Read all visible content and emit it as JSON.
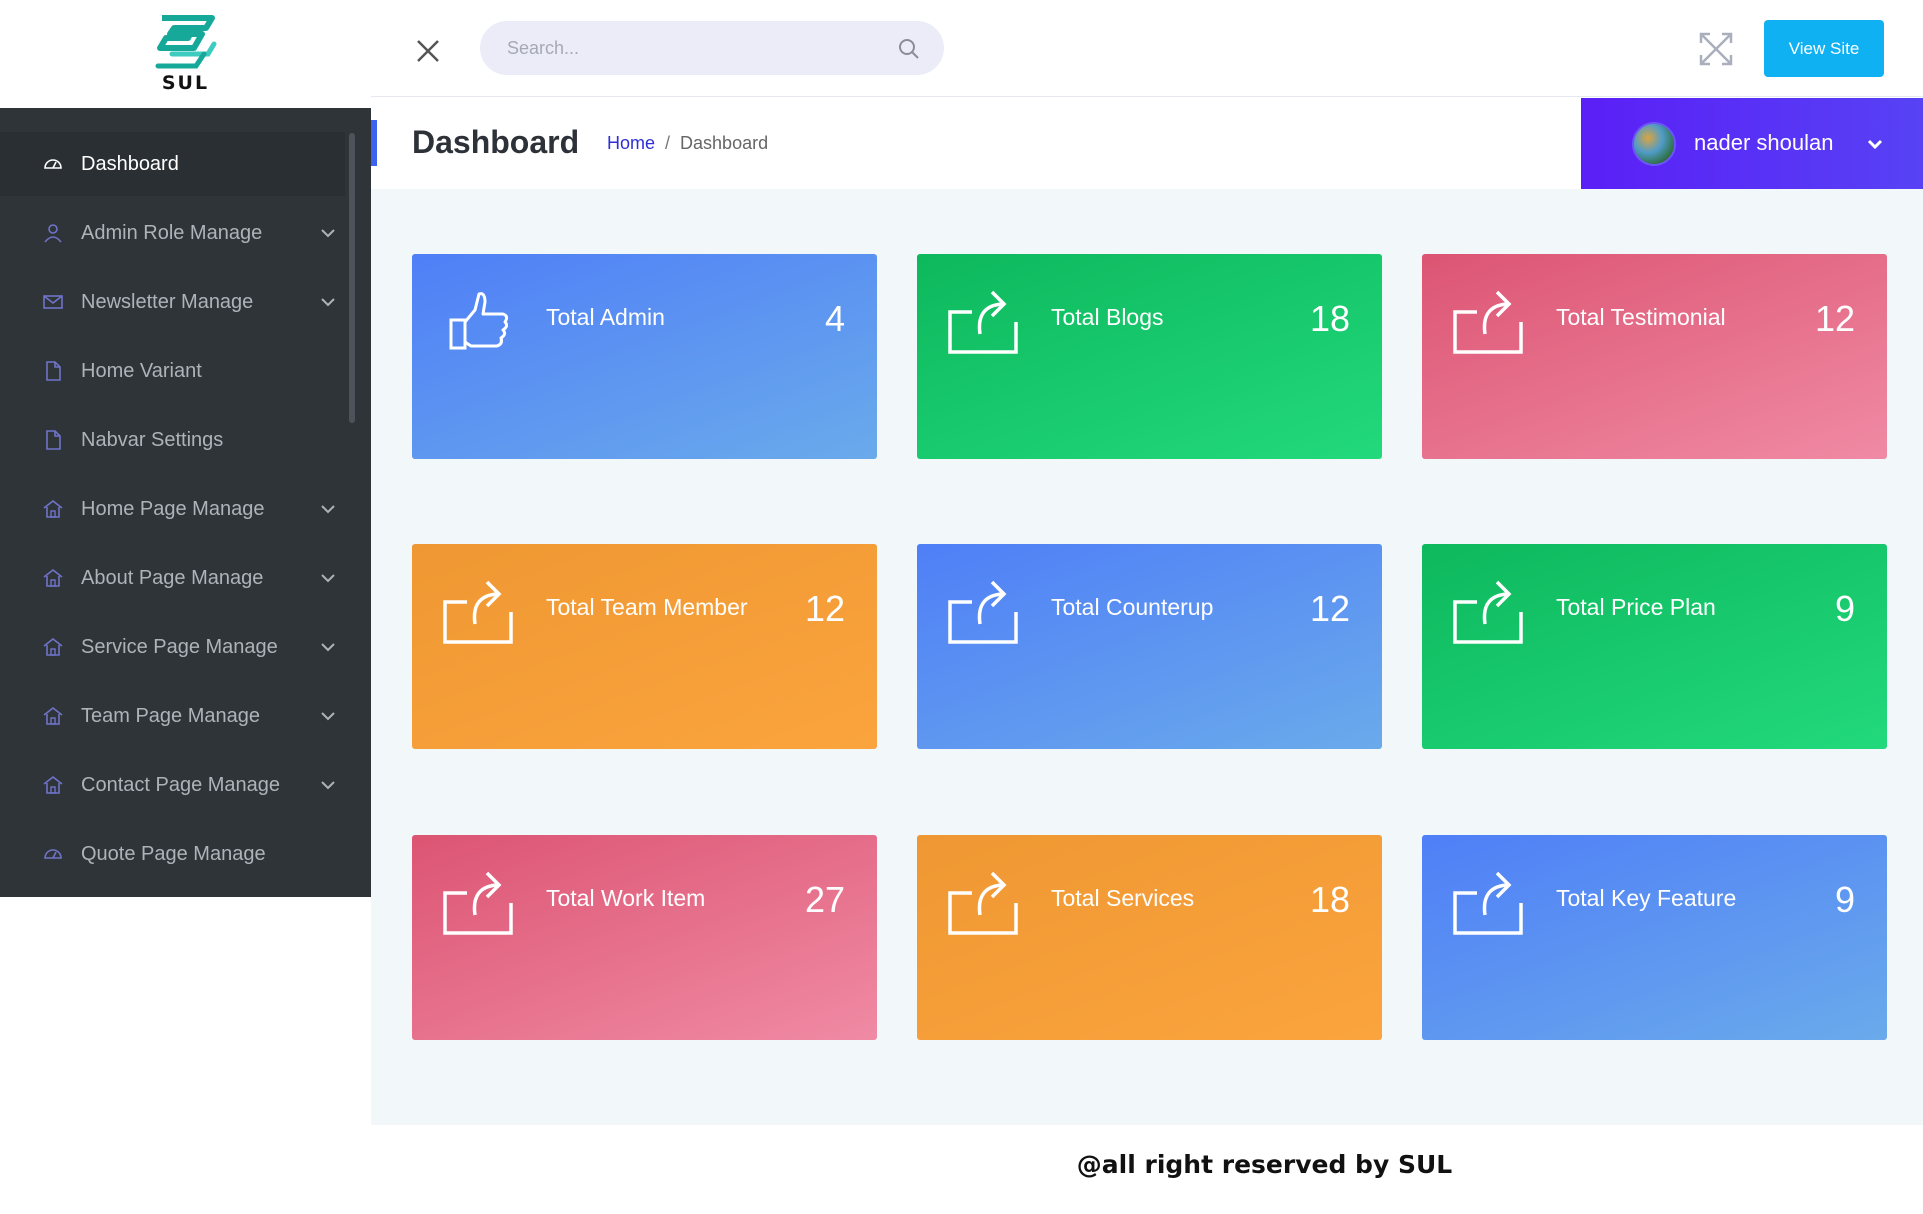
{
  "logo": {
    "text": "SUL"
  },
  "sidebar": {
    "items": [
      {
        "label": "Dashboard",
        "icon": "dashboard-icon",
        "active": true,
        "has_submenu": false
      },
      {
        "label": "Admin Role Manage",
        "icon": "user-icon",
        "active": false,
        "has_submenu": true
      },
      {
        "label": "Newsletter Manage",
        "icon": "envelope-icon",
        "active": false,
        "has_submenu": true
      },
      {
        "label": "Home Variant",
        "icon": "file-icon",
        "active": false,
        "has_submenu": false
      },
      {
        "label": "Nabvar Settings",
        "icon": "file-icon",
        "active": false,
        "has_submenu": false
      },
      {
        "label": "Home Page Manage",
        "icon": "home-icon",
        "active": false,
        "has_submenu": true
      },
      {
        "label": "About Page Manage",
        "icon": "home-icon",
        "active": false,
        "has_submenu": true
      },
      {
        "label": "Service Page Manage",
        "icon": "home-icon",
        "active": false,
        "has_submenu": true
      },
      {
        "label": "Team Page Manage",
        "icon": "home-icon",
        "active": false,
        "has_submenu": true
      },
      {
        "label": "Contact Page Manage",
        "icon": "home-icon",
        "active": false,
        "has_submenu": true
      },
      {
        "label": "Quote Page Manage",
        "icon": "dashboard-icon",
        "active": false,
        "has_submenu": false
      }
    ]
  },
  "topbar": {
    "search_placeholder": "Search...",
    "view_site_label": "View Site"
  },
  "header": {
    "title": "Dashboard",
    "breadcrumb": {
      "home": "Home",
      "separator": "/",
      "current": "Dashboard"
    },
    "user_name": "nader shoulan"
  },
  "cards": [
    {
      "label": "Total Admin",
      "value": "4",
      "icon": "thumbs-up-icon",
      "color": "blue"
    },
    {
      "label": "Total Blogs",
      "value": "18",
      "icon": "share-icon",
      "color": "green"
    },
    {
      "label": "Total Testimonial",
      "value": "12",
      "icon": "share-icon",
      "color": "pink"
    },
    {
      "label": "Total Team Member",
      "value": "12",
      "icon": "share-icon",
      "color": "orange"
    },
    {
      "label": "Total Counterup",
      "value": "12",
      "icon": "share-icon",
      "color": "blue"
    },
    {
      "label": "Total Price Plan",
      "value": "9",
      "icon": "share-icon",
      "color": "green"
    },
    {
      "label": "Total Work Item",
      "value": "27",
      "icon": "share-icon",
      "color": "pink"
    },
    {
      "label": "Total Services",
      "value": "18",
      "icon": "share-icon",
      "color": "orange"
    },
    {
      "label": "Total Key Feature",
      "value": "9",
      "icon": "share-icon",
      "color": "blue"
    }
  ],
  "footer": {
    "text": "@all right reserved by SUL"
  },
  "colors": {
    "sidebar_bg": "#2f3439",
    "accent_blue": "#3b63f0",
    "view_site_bg": "#0fb1f2",
    "user_panel_bg": "#5a1ff6",
    "content_bg": "#f2f7f9"
  }
}
